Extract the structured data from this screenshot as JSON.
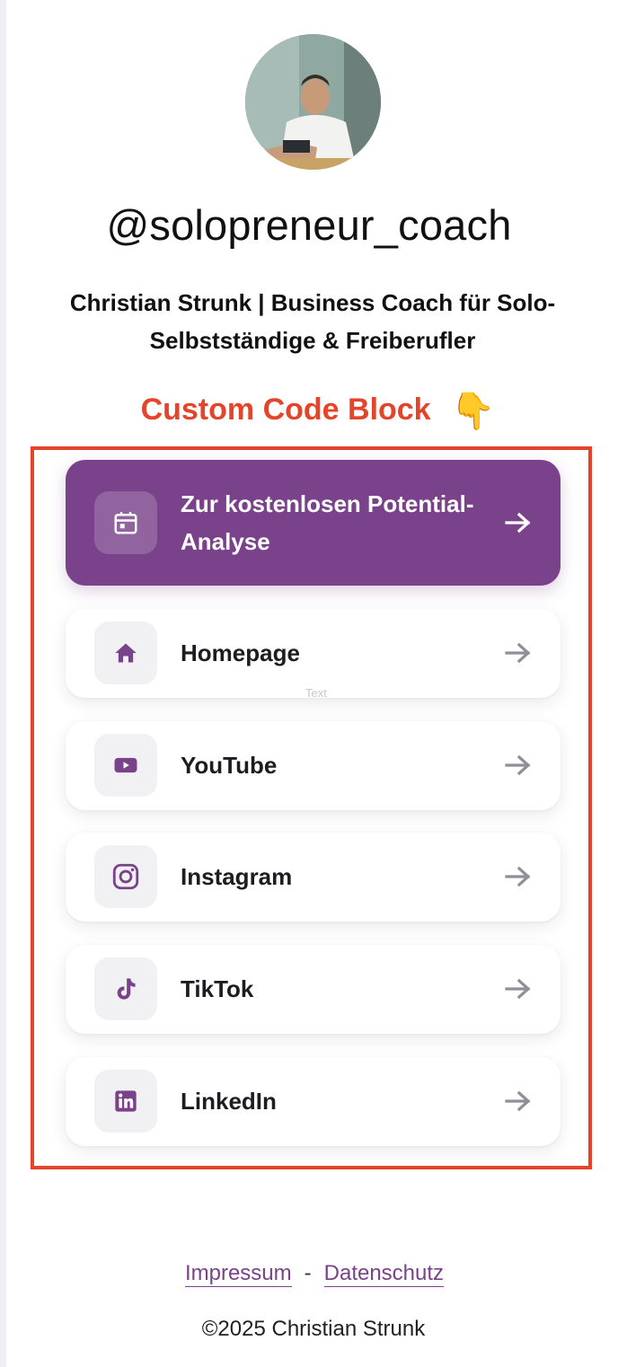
{
  "profile": {
    "username": "@solopreneur_coach",
    "bio": "Christian Strunk | Business Coach für Solo-Selbstständige & Freiberufler"
  },
  "custom_code": {
    "label": "Custom Code Block",
    "emoji": "👇"
  },
  "ghost_text": "Text",
  "links": [
    {
      "label": "Zur kostenlosen Potential-Analyse",
      "icon": "calendar-icon",
      "style": "primary"
    },
    {
      "label": "Homepage",
      "icon": "home-icon",
      "style": "default"
    },
    {
      "label": "YouTube",
      "icon": "youtube-icon",
      "style": "default"
    },
    {
      "label": "Instagram",
      "icon": "instagram-icon",
      "style": "default"
    },
    {
      "label": "TikTok",
      "icon": "tiktok-icon",
      "style": "default"
    },
    {
      "label": "LinkedIn",
      "icon": "linkedin-icon",
      "style": "default"
    }
  ],
  "footer": {
    "impressum": "Impressum",
    "separator": "-",
    "datenschutz": "Datenschutz",
    "copyright": "©2025 Christian Strunk"
  },
  "colors": {
    "accent": "#7a428a",
    "highlight_red": "#e4452a",
    "arrow_gray": "#8f8f99"
  }
}
